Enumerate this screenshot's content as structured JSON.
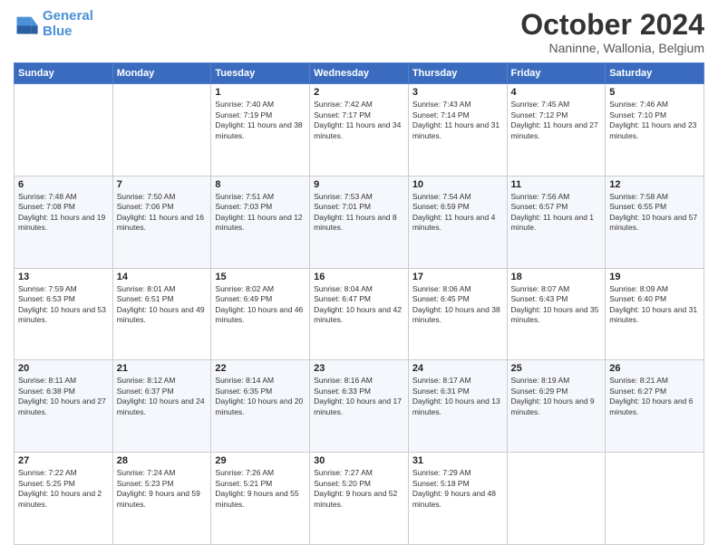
{
  "header": {
    "logo_line1": "General",
    "logo_line2": "Blue",
    "month": "October 2024",
    "location": "Naninne, Wallonia, Belgium"
  },
  "weekdays": [
    "Sunday",
    "Monday",
    "Tuesday",
    "Wednesday",
    "Thursday",
    "Friday",
    "Saturday"
  ],
  "weeks": [
    [
      {
        "day": "",
        "info": ""
      },
      {
        "day": "",
        "info": ""
      },
      {
        "day": "1",
        "info": "Sunrise: 7:40 AM\nSunset: 7:19 PM\nDaylight: 11 hours and 38 minutes."
      },
      {
        "day": "2",
        "info": "Sunrise: 7:42 AM\nSunset: 7:17 PM\nDaylight: 11 hours and 34 minutes."
      },
      {
        "day": "3",
        "info": "Sunrise: 7:43 AM\nSunset: 7:14 PM\nDaylight: 11 hours and 31 minutes."
      },
      {
        "day": "4",
        "info": "Sunrise: 7:45 AM\nSunset: 7:12 PM\nDaylight: 11 hours and 27 minutes."
      },
      {
        "day": "5",
        "info": "Sunrise: 7:46 AM\nSunset: 7:10 PM\nDaylight: 11 hours and 23 minutes."
      }
    ],
    [
      {
        "day": "6",
        "info": "Sunrise: 7:48 AM\nSunset: 7:08 PM\nDaylight: 11 hours and 19 minutes."
      },
      {
        "day": "7",
        "info": "Sunrise: 7:50 AM\nSunset: 7:06 PM\nDaylight: 11 hours and 16 minutes."
      },
      {
        "day": "8",
        "info": "Sunrise: 7:51 AM\nSunset: 7:03 PM\nDaylight: 11 hours and 12 minutes."
      },
      {
        "day": "9",
        "info": "Sunrise: 7:53 AM\nSunset: 7:01 PM\nDaylight: 11 hours and 8 minutes."
      },
      {
        "day": "10",
        "info": "Sunrise: 7:54 AM\nSunset: 6:59 PM\nDaylight: 11 hours and 4 minutes."
      },
      {
        "day": "11",
        "info": "Sunrise: 7:56 AM\nSunset: 6:57 PM\nDaylight: 11 hours and 1 minute."
      },
      {
        "day": "12",
        "info": "Sunrise: 7:58 AM\nSunset: 6:55 PM\nDaylight: 10 hours and 57 minutes."
      }
    ],
    [
      {
        "day": "13",
        "info": "Sunrise: 7:59 AM\nSunset: 6:53 PM\nDaylight: 10 hours and 53 minutes."
      },
      {
        "day": "14",
        "info": "Sunrise: 8:01 AM\nSunset: 6:51 PM\nDaylight: 10 hours and 49 minutes."
      },
      {
        "day": "15",
        "info": "Sunrise: 8:02 AM\nSunset: 6:49 PM\nDaylight: 10 hours and 46 minutes."
      },
      {
        "day": "16",
        "info": "Sunrise: 8:04 AM\nSunset: 6:47 PM\nDaylight: 10 hours and 42 minutes."
      },
      {
        "day": "17",
        "info": "Sunrise: 8:06 AM\nSunset: 6:45 PM\nDaylight: 10 hours and 38 minutes."
      },
      {
        "day": "18",
        "info": "Sunrise: 8:07 AM\nSunset: 6:43 PM\nDaylight: 10 hours and 35 minutes."
      },
      {
        "day": "19",
        "info": "Sunrise: 8:09 AM\nSunset: 6:40 PM\nDaylight: 10 hours and 31 minutes."
      }
    ],
    [
      {
        "day": "20",
        "info": "Sunrise: 8:11 AM\nSunset: 6:38 PM\nDaylight: 10 hours and 27 minutes."
      },
      {
        "day": "21",
        "info": "Sunrise: 8:12 AM\nSunset: 6:37 PM\nDaylight: 10 hours and 24 minutes."
      },
      {
        "day": "22",
        "info": "Sunrise: 8:14 AM\nSunset: 6:35 PM\nDaylight: 10 hours and 20 minutes."
      },
      {
        "day": "23",
        "info": "Sunrise: 8:16 AM\nSunset: 6:33 PM\nDaylight: 10 hours and 17 minutes."
      },
      {
        "day": "24",
        "info": "Sunrise: 8:17 AM\nSunset: 6:31 PM\nDaylight: 10 hours and 13 minutes."
      },
      {
        "day": "25",
        "info": "Sunrise: 8:19 AM\nSunset: 6:29 PM\nDaylight: 10 hours and 9 minutes."
      },
      {
        "day": "26",
        "info": "Sunrise: 8:21 AM\nSunset: 6:27 PM\nDaylight: 10 hours and 6 minutes."
      }
    ],
    [
      {
        "day": "27",
        "info": "Sunrise: 7:22 AM\nSunset: 5:25 PM\nDaylight: 10 hours and 2 minutes."
      },
      {
        "day": "28",
        "info": "Sunrise: 7:24 AM\nSunset: 5:23 PM\nDaylight: 9 hours and 59 minutes."
      },
      {
        "day": "29",
        "info": "Sunrise: 7:26 AM\nSunset: 5:21 PM\nDaylight: 9 hours and 55 minutes."
      },
      {
        "day": "30",
        "info": "Sunrise: 7:27 AM\nSunset: 5:20 PM\nDaylight: 9 hours and 52 minutes."
      },
      {
        "day": "31",
        "info": "Sunrise: 7:29 AM\nSunset: 5:18 PM\nDaylight: 9 hours and 48 minutes."
      },
      {
        "day": "",
        "info": ""
      },
      {
        "day": "",
        "info": ""
      }
    ]
  ]
}
